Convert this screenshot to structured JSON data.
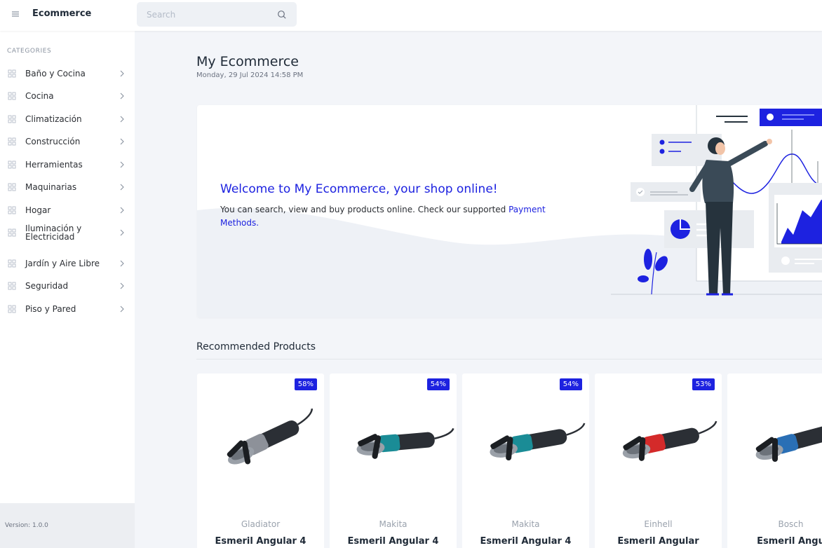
{
  "header": {
    "menu_icon": "hamburger-icon",
    "app_title": "Ecommerce",
    "search_placeholder": "Search",
    "search_icon": "search-icon"
  },
  "sidebar": {
    "section_title": "CATEGORIES",
    "items": [
      {
        "label": "Baño y Cocina"
      },
      {
        "label": "Cocina"
      },
      {
        "label": "Climatización"
      },
      {
        "label": "Construcción"
      },
      {
        "label": "Herramientas"
      },
      {
        "label": "Maquinarias"
      },
      {
        "label": "Hogar"
      },
      {
        "label": "Iluminación y Electricidad"
      },
      {
        "label": "Jardín y Aire Libre"
      },
      {
        "label": "Seguridad"
      },
      {
        "label": "Piso y Pared"
      }
    ],
    "item_icon": "grid-icon",
    "chevron_icon": "chevron-right-icon",
    "version": "Version: 1.0.0"
  },
  "main": {
    "title": "My Ecommerce",
    "date": "Monday, 29 Jul 2024 14:58 PM",
    "hero": {
      "title": "Welcome to My Ecommerce, your shop online!",
      "text": "You can search, view and buy products online. Check our supported ",
      "link": "Payment Methods."
    },
    "recommended_title": "Recommended Products",
    "products": [
      {
        "discount": "58%",
        "brand": "Gladiator",
        "name": "Esmeril Angular 4",
        "color": "#8d9199"
      },
      {
        "discount": "54%",
        "brand": "Makita",
        "name": "Esmeril Angular 4",
        "color": "#1a8c96"
      },
      {
        "discount": "54%",
        "brand": "Makita",
        "name": "Esmeril Angular 4",
        "color": "#1a8c96"
      },
      {
        "discount": "53%",
        "brand": "Einhell",
        "name": "Esmeril Angular",
        "color": "#d42a2a"
      },
      {
        "discount": "",
        "brand": "Bosch",
        "name": "Esmeril Angu",
        "color": "#2a6fb5"
      }
    ]
  },
  "colors": {
    "accent": "#1d22e0"
  }
}
